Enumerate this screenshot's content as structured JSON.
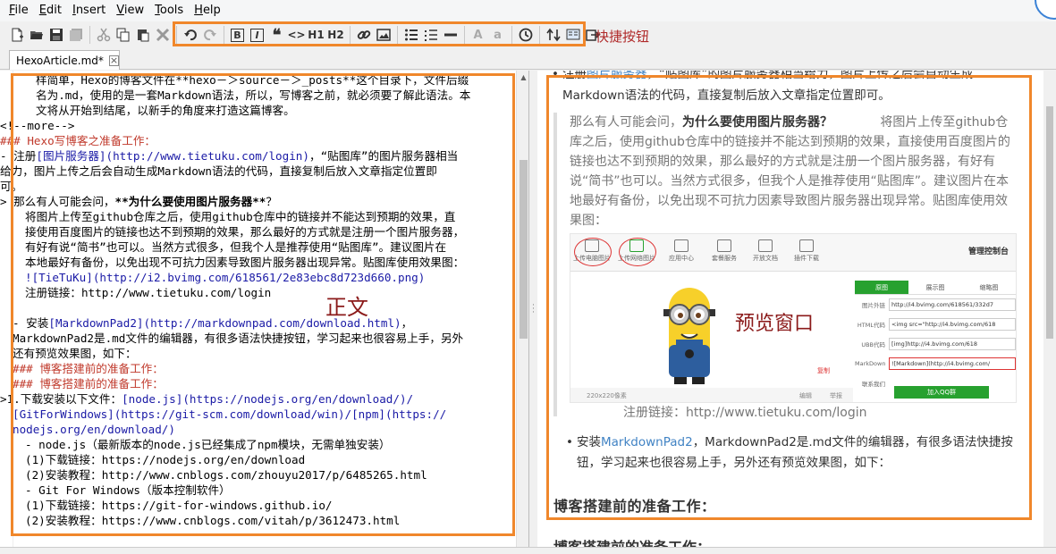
{
  "menu": {
    "file": "File",
    "file_key": "F",
    "edit": "Edit",
    "edit_key": "E",
    "insert": "Insert",
    "insert_key": "I",
    "view": "View",
    "view_key": "V",
    "tools": "Tools",
    "tools_key": "T",
    "help": "Help",
    "help_key": "H"
  },
  "toolbar": {
    "h1_label": "H1",
    "h2_label": "H2",
    "code_label": "<>",
    "bold_label": "B",
    "italic_label": "I",
    "font_a": "A",
    "font_a_small": "a"
  },
  "annotations": {
    "shortcut_label": "快捷按钮",
    "body_label": "正文",
    "preview_label": "预览窗口"
  },
  "tab": {
    "title": "HexoArticle.md",
    "modified": "*",
    "close": "×"
  },
  "editor": {
    "l1": "样简单，Hexo的博客文件在**hexo－＞source－＞_posts**这个目录下，文件后缀",
    "l2": "名为.md，使用的是一套Markdown语法，所以，写博客之前，就必须要了解此语法。本",
    "l3": "文将从开始到结尾，以新手的角度来打造这篇博客。",
    "l4": "<!--more-->",
    "l5": "### Hexo写博客之准备工作：",
    "l6a": "- 注册",
    "l6b": "[图片服务器](http://www.tietuku.com/login)",
    "l6c": "，“贴图库”的图片服务器相当",
    "l7": "给力，图片上传之后会自动生成Markdown语法的代码，直接复制后放入文章指定位置即",
    "l8": "可。",
    "l9a": "> 那么有人可能会问，",
    "l9b": "**为什么要使用图片服务器**",
    "l9c": "？",
    "l10": "将图片上传至github仓库之后，使用github仓库中的链接并不能达到预期的效果，直",
    "l11": "接使用百度图片的链接也达不到预期的效果，那么最好的方式就是注册一个图片服务器，",
    "l12": "有好有说“简书”也可以。当然方式很多，但我个人是推荐使用“贴图库”。建议图片在",
    "l13": "本地最好有备份，以免出现不可抗力因素导致图片服务器出现异常。贴图库使用效果图：",
    "l14": "![TieTuKu](http://i2.bvimg.com/618561/2e83ebc8d723d660.png)",
    "l15": "注册链接：http://www.tietuku.com/login",
    "l16a": "- 安装",
    "l16b": "[MarkdownPad2](http://markdownpad.com/download.html)",
    "l16c": "，",
    "l17": "MarkdownPad2是.md文件的编辑器，有很多语法快捷按钮，学习起来也很容易上手，另外",
    "l18": "还有预览效果图，如下：",
    "l19": "### 博客搭建前的准备工作：",
    "l20": "### 博客搭建前的准备工作：",
    "l21a": ">1.下载安装以下文件：",
    "l21b": "[node.js](https://nodejs.org/en/download/)",
    "l22": "[GitForWindows](https://git-scm.com/download/win)/[npm](https://",
    "l23": "nodejs.org/en/download/)",
    "l24": "- node.js（最新版本的node.js已经集成了npm模块，无需单独安装）",
    "l25": "(1)下载链接：https://nodejs.org/en/download",
    "l26": "(2)安装教程：http://www.cnblogs.com/zhouyu2017/p/6485265.html",
    "l27": "- Git For Windows（版本控制软件）",
    "l28": "(1)下载链接：https://git-for-windows.github.io/",
    "l29": "(2)安装教程：https://www.cnblogs.com/vitah/p/3612473.html"
  },
  "preview": {
    "top_line1a": "注册",
    "top_line1b": "图片服务器",
    "top_line1c": "，“贴图库”的图片服务器相当给力，图片上传之后会自动生成",
    "top_line2": "Markdown语法的代码，直接复制后放入文章指定位置即可。",
    "quote_a": "那么有人可能会问，",
    "quote_b": "为什么要使用图片服务器？",
    "quote_c": "将图片上传至github仓库之后，使用github仓库中的链接并不能达到预期的效果，直接使用百度图片的链接也达不到预期的效果，那么最好的方式就是注册一个图片服务器，有好有说“简书”也可以。当然方式很多，但我个人是推荐使用“贴图库”。建议图片在本地最好有备份，以免出现不可抗力因素导致图片服务器出现异常。贴图库使用效果图：",
    "note": "注册链接：http://www.tietuku.com/login",
    "bullet2a": "安装",
    "bullet2b": "MarkdownPad2",
    "bullet2c": "，MarkdownPad2是.md文件的编辑器，有很多语法快捷按钮，学习起来也很容易上手，另外还有预览效果图，如下：",
    "h3": "博客搭建前的准备工作：",
    "h3b": "博客搭建前的准备工作：",
    "img": {
      "icon1": "上传电脑图片",
      "icon2": "上传网络图片",
      "icon3": "应用中心",
      "icon4": "套餐服务",
      "icon5": "开放文档",
      "icon6": "插件下载",
      "brand": "管理控制台",
      "tab1": "原图",
      "tab2": "展示图",
      "tab3": "缩略图",
      "row1_label": "图片外链",
      "row1_val": "http://i4.bvimg.com/618561/332d7",
      "row2_label": "HTML代码",
      "row2_val": "<img src=\"http://i4.bvimg.com/618",
      "row3_label": "UBB代码",
      "row3_val": "[img]http://i4.bvimg.com/618",
      "row4_label": "MarkDown",
      "row4_val": "![Markdown](http://i4.bvimg.com/",
      "row5_label": "联系我们",
      "copy": "复制",
      "qq": "加入QQ群",
      "edit": "编辑",
      "report": "举报",
      "size": "220x220像素"
    }
  },
  "colors": {
    "callout": "#f0872b",
    "annotation_text": "#8b1a1a",
    "heading_red": "#c0392b",
    "link_blue": "#1a1aa6",
    "preview_link": "#4183c4",
    "accent_green": "#27a12f"
  }
}
